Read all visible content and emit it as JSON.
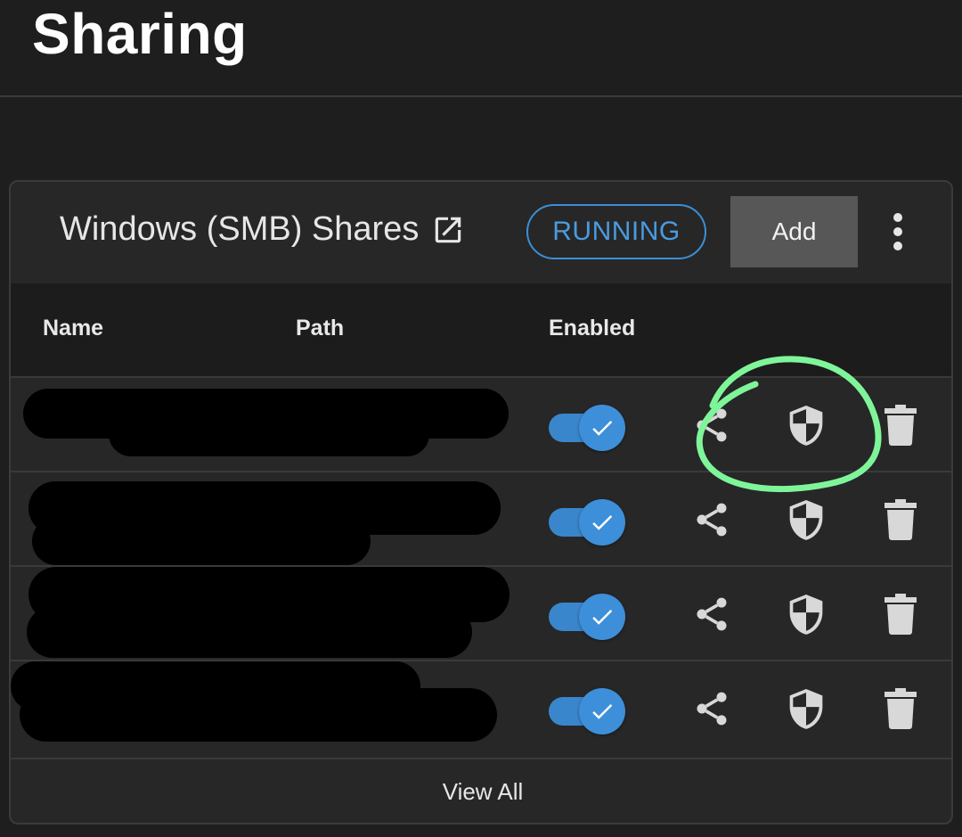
{
  "page": {
    "title": "Sharing"
  },
  "card": {
    "title": "Windows (SMB) Shares",
    "status": "RUNNING",
    "add_label": "Add",
    "view_all_label": "View All"
  },
  "table": {
    "columns": [
      "Name",
      "Path",
      "Enabled"
    ],
    "rows": [
      {
        "name": "",
        "path": "",
        "enabled": true
      },
      {
        "name": "",
        "path": "",
        "enabled": true
      },
      {
        "name": "",
        "path": "",
        "enabled": true
      },
      {
        "name": "",
        "path": "",
        "enabled": true
      }
    ]
  },
  "icons": {
    "external_link": "external-link-icon",
    "more": "more-vertical-icon",
    "check": "check-icon",
    "share": "share-icon",
    "security": "shield-icon",
    "delete": "trash-icon"
  },
  "colors": {
    "accent": "#3d8fd9",
    "annotation": "#7ff59a",
    "background": "#1e1e1e",
    "card": "#272727"
  }
}
